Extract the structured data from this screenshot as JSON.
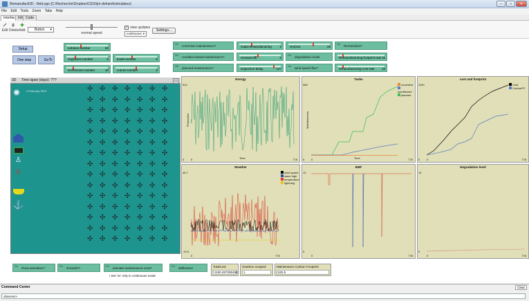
{
  "window": {
    "title": "RemanufactOD - NetLogo {C:\\Recherche\\Dropbox\\CESI\\jm-dehand\\simulateur}",
    "buttons": [
      "—",
      "□",
      "✕"
    ]
  },
  "menubar": [
    "File",
    "Edit",
    "Tools",
    "Zoom",
    "Tabs",
    "Help"
  ],
  "tabs": [
    "Interface",
    "Info",
    "Code"
  ],
  "toolbar": {
    "edit": "Edit",
    "delete": "Delete",
    "add": "Add",
    "widget_type": "Button",
    "speed_label": "normal speed",
    "view_updates_label": "view updates",
    "view_updates_mode": "continuous",
    "settings": "Settings..."
  },
  "controls": {
    "setup": "Setup",
    "one_step": "One step",
    "go": "Go",
    "sliders": [
      {
        "name": "turbines-number",
        "value": "60",
        "level": 0.35
      },
      {
        "name": "engineers-number",
        "value": "5",
        "level": 0.2
      },
      {
        "name": "technicians-number",
        "value": "10",
        "level": 0.15
      },
      {
        "name": "boats-number",
        "value": "6",
        "level": 0.4
      },
      {
        "name": "cranes-number",
        "value": "6",
        "level": 0.5
      },
      {
        "name": "Capa-remanufacturing",
        "value": "2",
        "level": 0.3
      },
      {
        "name": "renewal-diff",
        "value": "0",
        "level": 0.45
      },
      {
        "name": "inspection-delay",
        "value": "147",
        "level": 0.85
      },
      {
        "name": "Horizon",
        "value": "26",
        "level": 0.6
      },
      {
        "name": "Remanufacturing-footprint-rate",
        "value": "15",
        "level": 0.1
      },
      {
        "name": "remanufacturing-cost-rate",
        "value": "15",
        "level": 0.1
      }
    ],
    "switches": [
      {
        "name": "corrective-maintenance?",
        "state": "On"
      },
      {
        "name": "condition-based-maintenance?",
        "state": "On"
      },
      {
        "name": "planned-maintenance?",
        "state": "Off"
      },
      {
        "name": "degradation-mode",
        "state": "On"
      },
      {
        "name": "wind-speed-flux?",
        "state": "On"
      },
      {
        "name": "Remanufact?",
        "state": "On"
      }
    ]
  },
  "world": {
    "time_label": "Time lapse (days): ???",
    "date": "4 February 2013",
    "zoom": "3D"
  },
  "plots": [
    {
      "title": "Energy",
      "ylabel": "Production",
      "xlabel": "Time",
      "ymax": "510",
      "ymin": "0",
      "xmin": "0",
      "xmax": "778"
    },
    {
      "title": "Tasks",
      "ylabel": "Maintenances",
      "xlabel": "Time",
      "ymax": "365",
      "ymin": "0",
      "xmin": "0",
      "xmax": "778",
      "legend": [
        "corrective",
        "conditioned",
        "planned"
      ]
    },
    {
      "title": "cost and footprint",
      "ylabel": "",
      "xlabel": "",
      "ymax": "1190",
      "ymin": "0",
      "xmin": "0",
      "xmax": "778",
      "legend": [
        "Cost",
        "CarbonFP"
      ]
    },
    {
      "title": "Weather",
      "ylabel": "",
      "xlabel": "",
      "ymax": "48.7",
      "ymin": "-14.5",
      "xmin": "0",
      "xmax": "778",
      "legend": [
        "wind speed",
        "wave high",
        "temperature",
        "lightning"
      ]
    },
    {
      "title": "EMF",
      "ylabel": "",
      "xlabel": "",
      "ymax": "10",
      "ymin": "0",
      "xmin": "0",
      "xmax": "778"
    },
    {
      "title": "Degradation level",
      "ylabel": "",
      "xlabel": "",
      "ymax": "10",
      "ymin": "0",
      "xmin": "0",
      "xmax": "778"
    }
  ],
  "bottom": {
    "show_animation": "show-animation?",
    "show_info": "showinfo?",
    "animate_crew": "animate-maintenance-crew?",
    "defilement": "defilement",
    "note": "! Set 'on' only in continuous mode",
    "monitors": [
      {
        "label": "TotalCost",
        "value": "1150.497385456"
      },
      {
        "label": "Gearbox scraped",
        "value": "1"
      },
      {
        "label": "Maintenance Carbon Footprint",
        "value": "625.5"
      }
    ]
  },
  "command_center": {
    "title": "Command Center",
    "clear": "Clear",
    "prompt": "observer>"
  },
  "colors": {
    "slider": "#6dbea0",
    "button": "#b7c8e6",
    "world": "#1e948f",
    "plot_bg": "#e0dfb7"
  }
}
